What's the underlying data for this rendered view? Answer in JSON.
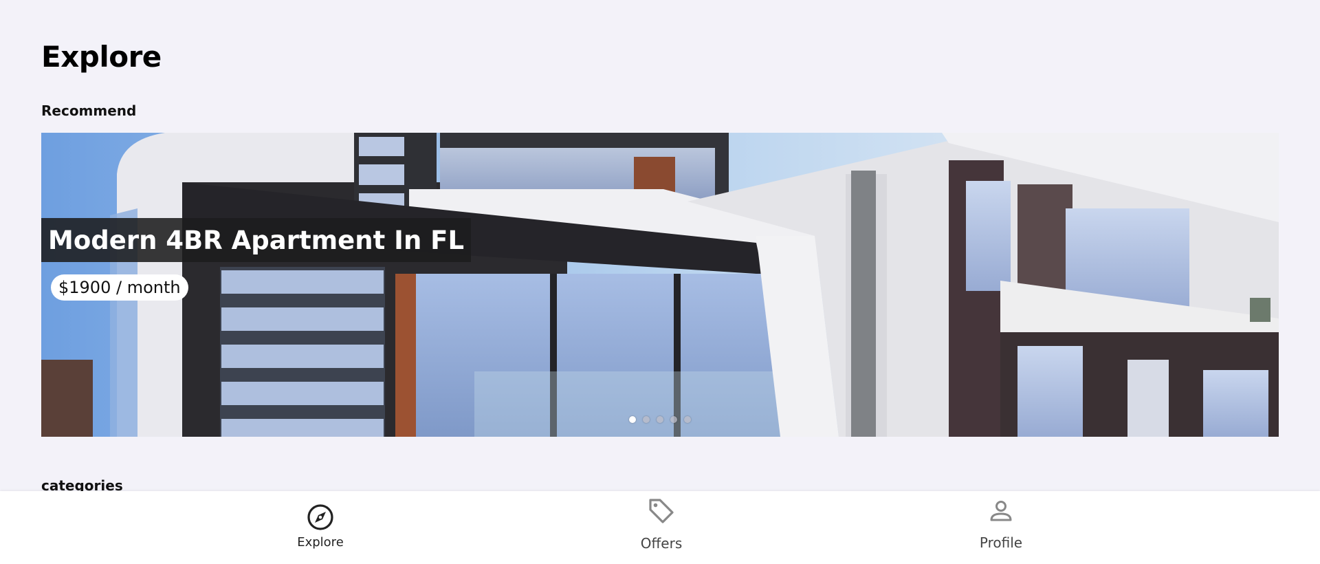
{
  "header": {
    "title": "Explore"
  },
  "sections": {
    "recommend_label": "Recommend",
    "categories_label": "categories"
  },
  "carousel": {
    "title": "Modern 4BR Apartment In FL",
    "price": "$1900 / month",
    "slide_count": 5,
    "active_slide": 1
  },
  "nav": {
    "items": [
      {
        "label": "Explore",
        "icon": "compass-icon",
        "active": true
      },
      {
        "label": "Offers",
        "icon": "tag-icon",
        "active": false
      },
      {
        "label": "Profile",
        "icon": "person-icon",
        "active": false
      }
    ]
  },
  "colors": {
    "background": "#f3f2f9",
    "nav_background": "#ffffff",
    "title_box": "#1c1c1e",
    "active_icon": "#222222",
    "inactive_icon": "#888888"
  }
}
